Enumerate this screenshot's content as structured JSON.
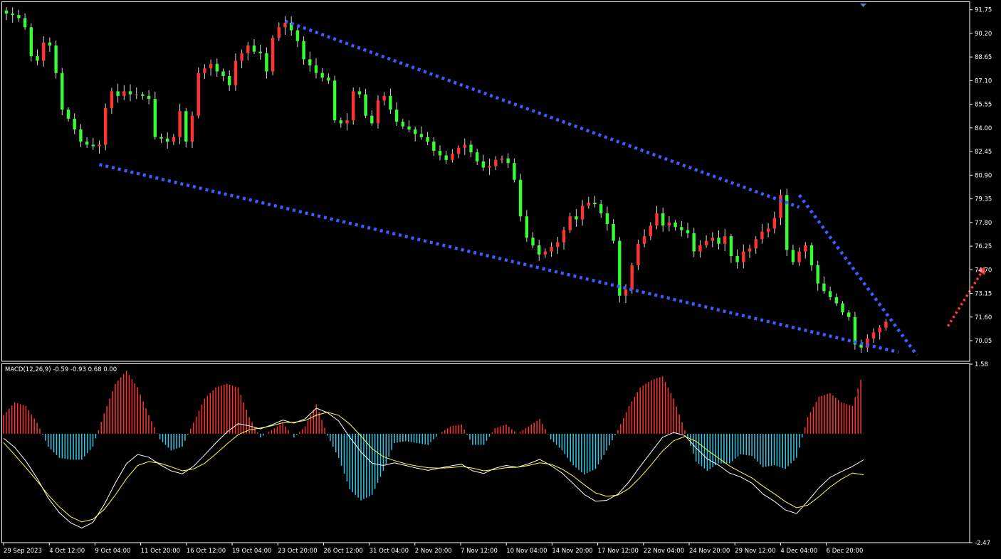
{
  "chart_data": {
    "type": "candlestick",
    "price_panel": {
      "y_ticks": [
        "91.75",
        "90.20",
        "88.65",
        "87.10",
        "85.55",
        "84.00",
        "82.45",
        "80.90",
        "79.35",
        "77.80",
        "76.25",
        "74.70",
        "73.15",
        "71.60",
        "70.05"
      ],
      "ylim": [
        68.7,
        92.2
      ],
      "closes": [
        91.5,
        91.4,
        91.2,
        90.6,
        88.7,
        88.4,
        89.6,
        89.4,
        87.6,
        85.2,
        84.6,
        83.9,
        83.1,
        82.9,
        82.8,
        82.9,
        85.3,
        86.4,
        86.1,
        86.4,
        86.2,
        86.2,
        86.1,
        85.9,
        83.4,
        83.3,
        83.1,
        83.4,
        85.1,
        83.1,
        84.8,
        87.6,
        87.9,
        88.2,
        87.7,
        87.4,
        86.8,
        88.4,
        88.9,
        89.4,
        89.0,
        88.9,
        87.7,
        89.9,
        90.6,
        90.9,
        90.4,
        89.7,
        88.5,
        88.1,
        87.6,
        87.3,
        87.1,
        84.5,
        84.3,
        84.5,
        86.4,
        86.2,
        84.8,
        84.3,
        85.8,
        86.1,
        85.2,
        84.4,
        84.1,
        83.9,
        83.6,
        83.4,
        83.1,
        82.5,
        82.2,
        81.9,
        82.3,
        82.7,
        82.9,
        82.4,
        81.8,
        81.4,
        81.5,
        81.9,
        82.0,
        81.7,
        80.6,
        78.2,
        76.8,
        76.3,
        75.7,
        75.9,
        76.2,
        76.5,
        77.3,
        78.2,
        78.0,
        78.9,
        79.1,
        79.0,
        78.4,
        77.7,
        76.6,
        73.0,
        73.4,
        75.0,
        76.4,
        76.9,
        77.6,
        78.4,
        77.6,
        77.8,
        77.5,
        77.3,
        77.1,
        75.9,
        76.3,
        76.6,
        76.8,
        76.4,
        76.9,
        75.6,
        75.2,
        75.9,
        76.1,
        76.7,
        77.2,
        77.4,
        78.1,
        79.6,
        76.0,
        75.2,
        75.9,
        76.3,
        75.0,
        73.8,
        73.3,
        72.9,
        72.5,
        71.9,
        71.6,
        69.8,
        69.6,
        70.2,
        70.6,
        70.9,
        71.3
      ],
      "last_price": 71.3,
      "channel_upper": {
        "start": [
          45,
          91.0
        ],
        "end": [
          128,
          78.8
        ]
      },
      "channel_lower": {
        "start": [
          15,
          81.6
        ],
        "end": [
          144,
          69.3
        ]
      },
      "breakout_trendline": {
        "start": [
          128,
          79.6
        ],
        "end": [
          147,
          69.1
        ]
      },
      "projection_arrow": {
        "start": [
          152,
          71.0
        ],
        "end": [
          158,
          74.9
        ],
        "color": "#ff3b3b"
      }
    },
    "macd_panel": {
      "label": "MACD(12,26,9) -0.59 -0.93 0.68 0.00",
      "y_ticks": [
        "1.58",
        "-2.47"
      ],
      "ylim": [
        -2.47,
        1.58
      ],
      "macd": [
        -0.1,
        -0.31,
        -0.62,
        -1.01,
        -1.46,
        -1.79,
        -2.02,
        -2.14,
        -2.01,
        -1.61,
        -1.12,
        -0.68,
        -0.47,
        -0.53,
        -0.7,
        -0.84,
        -0.91,
        -0.74,
        -0.48,
        -0.21,
        0.04,
        0.23,
        0.18,
        0.11,
        0.2,
        0.31,
        0.24,
        0.34,
        0.58,
        0.48,
        0.29,
        -0.08,
        -0.41,
        -0.67,
        -0.72,
        -0.66,
        -0.72,
        -0.78,
        -0.83,
        -0.78,
        -0.73,
        -0.69,
        -0.84,
        -0.9,
        -0.78,
        -0.72,
        -0.76,
        -0.68,
        -0.58,
        -0.72,
        -0.89,
        -1.13,
        -1.38,
        -1.53,
        -1.51,
        -1.37,
        -1.09,
        -0.74,
        -0.41,
        -0.08,
        0.03,
        -0.04,
        -0.32,
        -0.57,
        -0.71,
        -0.89,
        -0.98,
        -1.12,
        -1.37,
        -1.53,
        -1.73,
        -1.81,
        -1.53,
        -1.23,
        -0.99,
        -0.86,
        -0.74,
        -0.59
      ],
      "signal": [
        -0.2,
        -0.48,
        -0.77,
        -1.07,
        -1.39,
        -1.66,
        -1.88,
        -2.0,
        -1.94,
        -1.72,
        -1.39,
        -1.02,
        -0.72,
        -0.63,
        -0.67,
        -0.75,
        -0.84,
        -0.8,
        -0.67,
        -0.46,
        -0.23,
        -0.02,
        0.09,
        0.13,
        0.18,
        0.25,
        0.26,
        0.3,
        0.42,
        0.49,
        0.42,
        0.22,
        -0.05,
        -0.34,
        -0.52,
        -0.61,
        -0.68,
        -0.73,
        -0.77,
        -0.78,
        -0.77,
        -0.74,
        -0.78,
        -0.84,
        -0.81,
        -0.77,
        -0.76,
        -0.72,
        -0.66,
        -0.69,
        -0.8,
        -0.96,
        -1.16,
        -1.34,
        -1.42,
        -1.39,
        -1.24,
        -0.99,
        -0.7,
        -0.39,
        -0.16,
        -0.06,
        -0.17,
        -0.37,
        -0.55,
        -0.73,
        -0.87,
        -1.0,
        -1.19,
        -1.36,
        -1.54,
        -1.68,
        -1.62,
        -1.43,
        -1.21,
        -1.03,
        -0.89,
        -0.93
      ]
    },
    "x_ticks": [
      "29 Sep 2023",
      "4 Oct 12:00",
      "9 Oct 04:00",
      "11 Oct 20:00",
      "16 Oct 12:00",
      "19 Oct 04:00",
      "23 Oct 20:00",
      "26 Oct 12:00",
      "31 Oct 04:00",
      "2 Nov 20:00",
      "7 Nov 12:00",
      "10 Nov 04:00",
      "14 Nov 20:00",
      "17 Nov 12:00",
      "22 Nov 04:00",
      "24 Nov 20:00",
      "29 Nov 12:00",
      "4 Dec 04:00",
      "6 Dec 20:00"
    ],
    "colors": {
      "background": "#000000",
      "up": "#ff3333",
      "down": "#33ff33",
      "wick": "#d8d8d8",
      "channel": "#3c5cff",
      "macd_pos": "#ff3333",
      "macd_neg": "#33c8e6",
      "macd_line": "#ffffff",
      "signal_line": "#ffff55",
      "axis": "#ffffff"
    }
  }
}
